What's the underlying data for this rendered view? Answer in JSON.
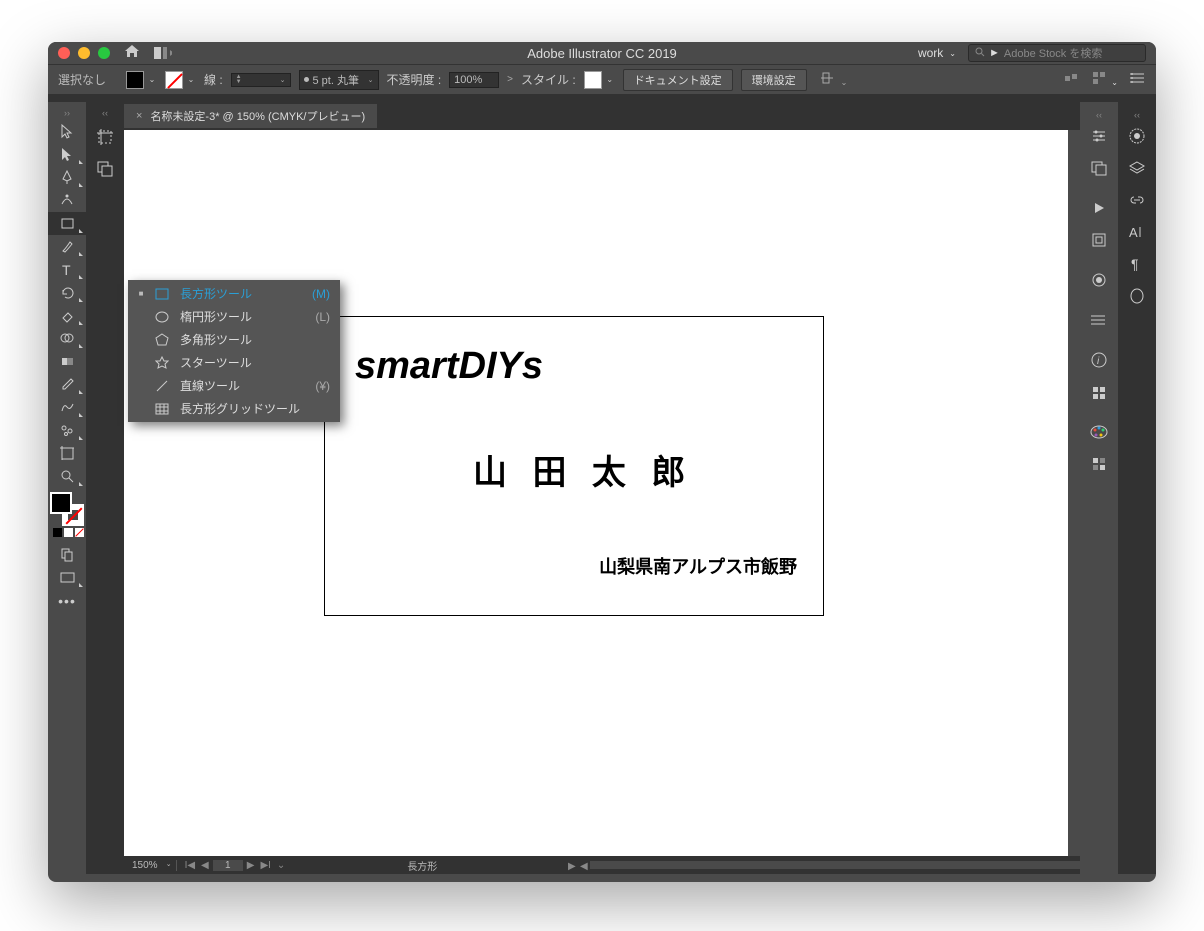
{
  "titlebar": {
    "app_title": "Adobe Illustrator CC 2019",
    "workspace": "work",
    "search_placeholder": "Adobe Stock を検索"
  },
  "controlbar": {
    "selection": "選択なし",
    "stroke_label": "線 :",
    "stroke_weight_value": "5 pt. 丸筆",
    "opacity_label": "不透明度 :",
    "opacity_value": "100%",
    "style_label": "スタイル :",
    "doc_setup": "ドキュメント設定",
    "env_setup": "環境設定"
  },
  "doctab": {
    "label": "名称未設定-3* @ 150% (CMYK/プレビュー)"
  },
  "flyout": {
    "items": [
      {
        "label": "長方形ツール",
        "key": "(M)",
        "selected": true
      },
      {
        "label": "楕円形ツール",
        "key": "(L)",
        "selected": false
      },
      {
        "label": "多角形ツール",
        "key": "",
        "selected": false
      },
      {
        "label": "スターツール",
        "key": "",
        "selected": false
      },
      {
        "label": "直線ツール",
        "key": "(¥)",
        "selected": false
      },
      {
        "label": "長方形グリッドツール",
        "key": "",
        "selected": false
      }
    ]
  },
  "artboard": {
    "company": "smartDIYs",
    "name": "山 田 太 郎",
    "address": "山梨県南アルプス市飯野"
  },
  "statusbar": {
    "zoom": "150%",
    "page": "1",
    "tool_desc": "長方形"
  }
}
